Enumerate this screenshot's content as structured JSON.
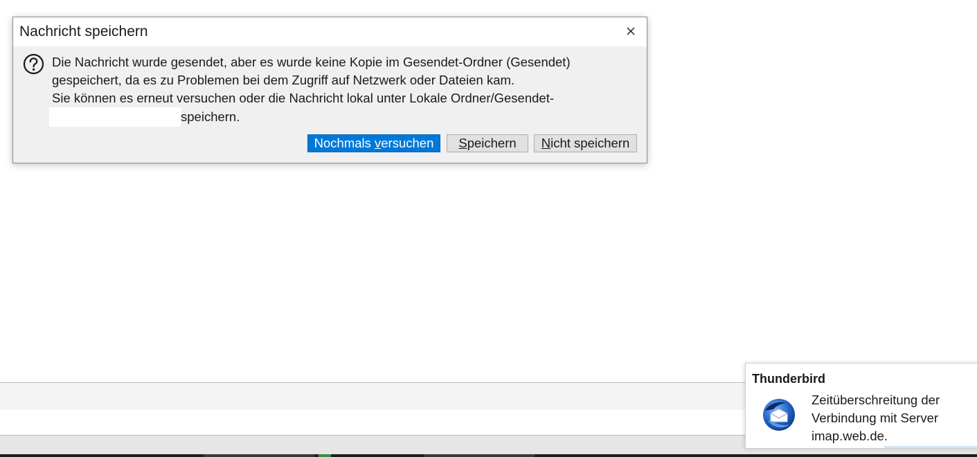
{
  "dialog": {
    "title": "Nachricht speichern",
    "icon": "question-icon",
    "message_lines": [
      "Die Nachricht wurde gesendet, aber es wurde keine Kopie im Gesendet-Ordner (Gesendet)",
      "gespeichert, da es zu Problemen bei dem Zugriff auf Netzwerk oder Dateien kam.",
      "Sie können es erneut versuchen oder die Nachricht lokal unter Lokale Ordner/Gesendet-",
      "speichern."
    ],
    "buttons": {
      "retry": {
        "pre": "Nochmals ",
        "accel": "v",
        "post": "ersuchen"
      },
      "save": {
        "pre": "",
        "accel": "S",
        "post": "peichern"
      },
      "dont_save": {
        "pre": "",
        "accel": "N",
        "post": "icht speichern"
      }
    },
    "accent_color": "#0078d7"
  },
  "notification": {
    "app_name": "Thunderbird",
    "icon": "thunderbird-logo-icon",
    "lines": [
      "Zeitüberschreitung der",
      "Verbindung mit Server",
      "imap.web.de."
    ]
  }
}
